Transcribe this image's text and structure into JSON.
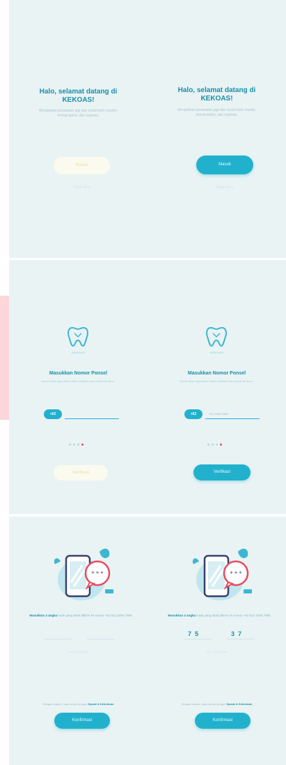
{
  "welcome": {
    "title_line1": "Halo, selamat datang di",
    "title_line2": "KEKOAS!",
    "subtitle": "Menjadikan perawatan gigi dan mulut lebih mudah, hemat waktu, dan nyaman.",
    "login_label": "Masuk",
    "register_label": "Daftar Baru"
  },
  "phone_step": {
    "brand": "KEKOAS",
    "title": "Masukkan Nomor Ponsel",
    "subtitle": "Nomor akan digunakan untuk verifikasi dan masuk ke akun.",
    "country_code": "+62",
    "phone_value": "812 3456 7890",
    "verify_label": "Verifikasi"
  },
  "otp_step": {
    "title_bold": "Masukkan 4 angka",
    "title_rest": "kode yang telah dikirim ke nomor +62 812 3456 7890",
    "digits": [
      "7",
      "5",
      "3",
      "7"
    ],
    "resend": "Kirim ulang kode",
    "policy_prefix": "Dengan masuk, saya setuju dengan",
    "policy_link": "Syarat & Ketentuan",
    "confirm_label": "Konfirmasi"
  },
  "colors": {
    "brand": "#22b1cd",
    "panel": "#e9f3f4",
    "accent": "#e84a5f",
    "title": "#1a8ea8"
  },
  "icons": [
    "tooth-icon",
    "phone-chat-illustration"
  ]
}
